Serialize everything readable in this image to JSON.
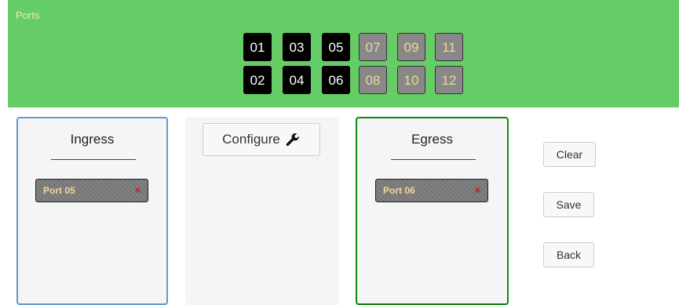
{
  "ports": {
    "title": "Ports",
    "items": [
      {
        "label": "01",
        "state": "active"
      },
      {
        "label": "03",
        "state": "active"
      },
      {
        "label": "05",
        "state": "active"
      },
      {
        "label": "07",
        "state": "inactive"
      },
      {
        "label": "09",
        "state": "inactive"
      },
      {
        "label": "11",
        "state": "inactive"
      },
      {
        "label": "02",
        "state": "active"
      },
      {
        "label": "04",
        "state": "active"
      },
      {
        "label": "06",
        "state": "active"
      },
      {
        "label": "08",
        "state": "inactive"
      },
      {
        "label": "10",
        "state": "inactive"
      },
      {
        "label": "12",
        "state": "inactive"
      }
    ]
  },
  "ingress": {
    "title": "Ingress",
    "chip_label": "Port 05",
    "chip_remove": "×"
  },
  "configure": {
    "label": "Configure",
    "icon": "wrench-icon"
  },
  "egress": {
    "title": "Egress",
    "chip_label": "Port 06",
    "chip_remove": "×"
  },
  "actions": {
    "clear_label": "Clear",
    "save_label": "Save",
    "back_label": "Back"
  },
  "colors": {
    "ports_bar": "#66cc66",
    "ingress_border": "#6699cc",
    "egress_border": "#0f860f",
    "port_active": "#000000",
    "port_inactive": "#888888",
    "port_inactive_text": "#f3d49a",
    "remove_x": "#d11a1a"
  }
}
